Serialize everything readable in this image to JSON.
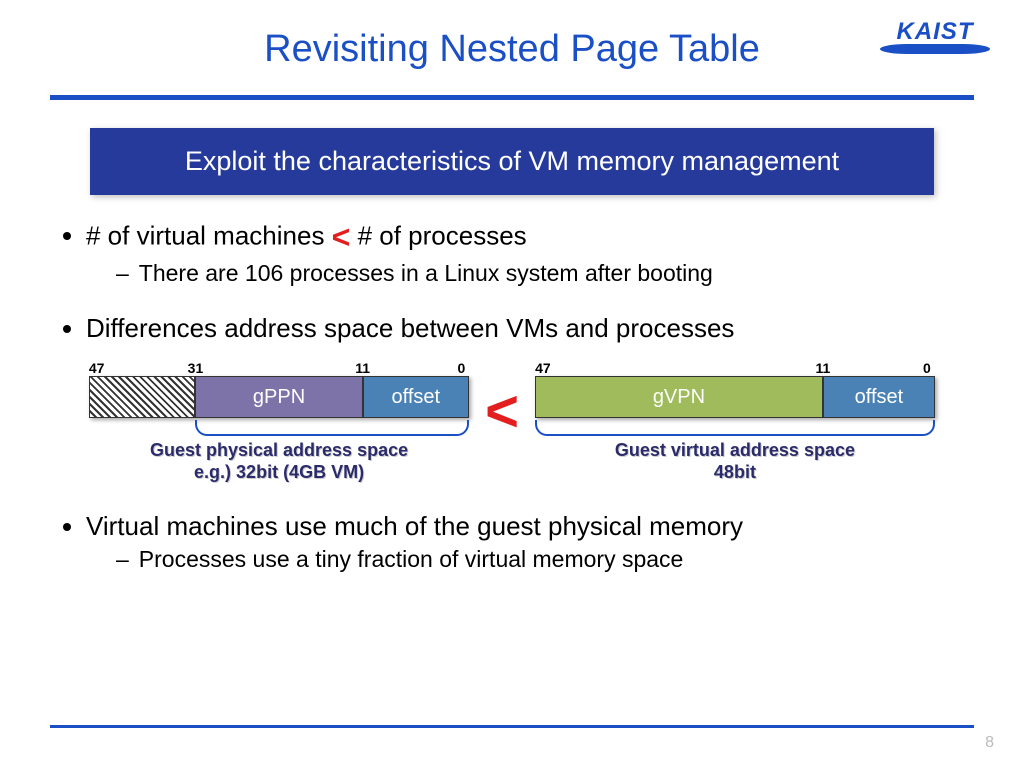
{
  "logo": "KAIST",
  "title": "Revisiting Nested Page Table",
  "banner": "Exploit the characteristics of VM memory management",
  "bullet1": {
    "pre": "# of virtual machines ",
    "mid": "<",
    "post": " # of processes"
  },
  "sub1": "There are 106 processes in a Linux system after booting",
  "bullet2": "Differences address space between VMs and processes",
  "left_bits": {
    "b47": "47",
    "b31": "31",
    "b11": "11",
    "b0": "0"
  },
  "left_seg": {
    "gppn": "gPPN",
    "offset": "offset"
  },
  "left_caption_l1": "Guest physical address space",
  "left_caption_l2": "e.g.) 32bit (4GB VM)",
  "compare": "<",
  "right_bits": {
    "b47": "47",
    "b11": "11",
    "b0": "0"
  },
  "right_seg": {
    "gvpn": "gVPN",
    "offset": "offset"
  },
  "right_caption_l1": "Guest virtual address space",
  "right_caption_l2": "48bit",
  "bullet3": "Virtual machines use much of the guest physical memory",
  "sub3": "Processes use a tiny fraction of virtual memory space",
  "page": "8"
}
